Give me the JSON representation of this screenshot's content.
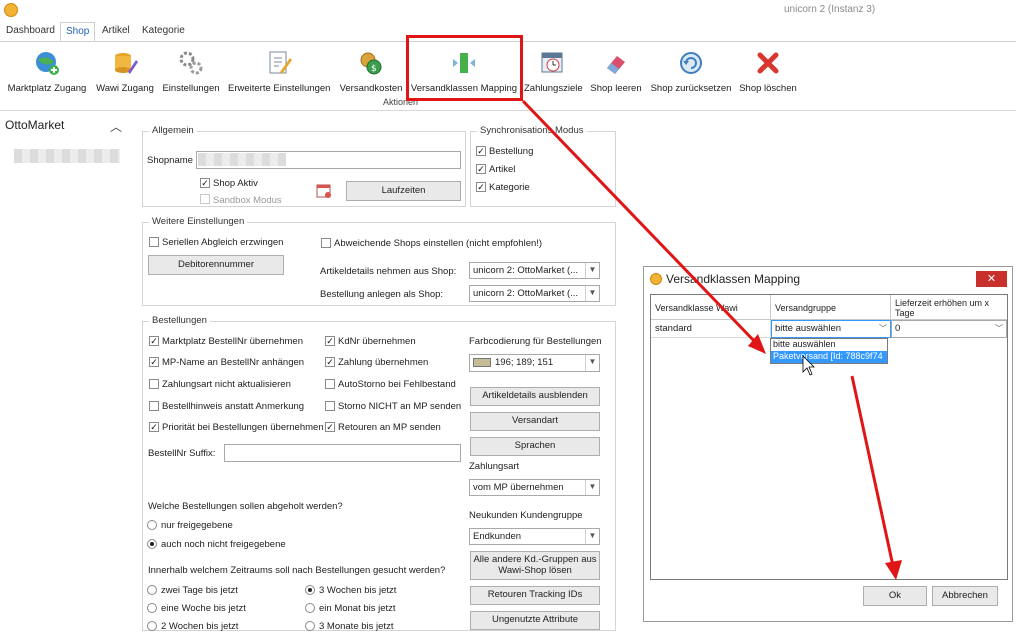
{
  "window": {
    "title": "unicorn 2 (Instanz 3)"
  },
  "tabs": [
    "Dashboard",
    "Shop",
    "Artikel",
    "Kategorie"
  ],
  "ribbon": {
    "group_label": "Aktionen",
    "buttons": [
      {
        "label": "Marktplatz Zugang",
        "icon": "globe-plus-icon"
      },
      {
        "label": "Wawi Zugang",
        "icon": "database-pencil-icon"
      },
      {
        "label": "Einstellungen",
        "icon": "gears-icon"
      },
      {
        "label": "Erweiterte Einstellungen",
        "icon": "document-pencil-icon"
      },
      {
        "label": "Versandkosten",
        "icon": "coins-icon"
      },
      {
        "label": "Versandklassen Mapping",
        "icon": "mapping-arrows-icon"
      },
      {
        "label": "Zahlungsziele",
        "icon": "calendar-clock-icon"
      },
      {
        "label": "Shop leeren",
        "icon": "eraser-icon"
      },
      {
        "label": "Shop zurücksetzen",
        "icon": "reset-icon"
      },
      {
        "label": "Shop löschen",
        "icon": "red-x-icon"
      }
    ]
  },
  "sidebar": {
    "title": "OttoMarket"
  },
  "allgemein": {
    "title": "Allgemein",
    "shopname_label": "Shopname",
    "shop_aktiv": "Shop Aktiv",
    "sandbox": "Sandbox Modus",
    "laufzeiten": "Laufzeiten"
  },
  "sync": {
    "title": "Synchronisations Modus",
    "items": [
      "Bestellung",
      "Artikel",
      "Kategorie"
    ]
  },
  "weitere": {
    "title": "Weitere Einstellungen",
    "seriellen": "Seriellen Abgleich erzwingen",
    "debitoren": "Debitorennummer",
    "abweichende": "Abweichende Shops einstellen (nicht empfohlen!)",
    "artikeldetails_label": "Artikeldetails nehmen aus Shop:",
    "artikeldetails_value": "unicorn 2: OttoMarket (...",
    "bestellung_label": "Bestellung anlegen als Shop:",
    "bestellung_value": "unicorn 2: OttoMarket (..."
  },
  "bestellungen": {
    "title": "Bestellungen",
    "left_checks": [
      {
        "label": "Marktplatz BestellNr übernehmen",
        "checked": true
      },
      {
        "label": "MP-Name an BestellNr anhängen",
        "checked": true
      },
      {
        "label": "Zahlungsart nicht aktualisieren",
        "checked": false
      },
      {
        "label": "Bestellhinweis anstatt Anmerkung",
        "checked": false
      },
      {
        "label": "Priorität bei Bestellungen übernehmen",
        "checked": true
      }
    ],
    "mid_checks": [
      {
        "label": "KdNr übernehmen",
        "checked": true
      },
      {
        "label": "Zahlung übernehmen",
        "checked": true
      },
      {
        "label": "AutoStorno bei Fehlbestand",
        "checked": false
      },
      {
        "label": "Storno NICHT an MP senden",
        "checked": false
      },
      {
        "label": "Retouren an MP senden",
        "checked": true
      }
    ],
    "suffix_label": "BestellNr Suffix:",
    "farbcodierung_label": "Farbcodierung für Bestellungen",
    "farb_value": "196; 189; 151",
    "farb_color": "#c4bd97",
    "buttons": [
      "Artikeldetails ausblenden",
      "Versandart",
      "Sprachen"
    ],
    "zahlungsart_label": "Zahlungsart",
    "zahlungsart_value": "vom MP übernehmen",
    "neukunden_label": "Neukunden Kundengruppe",
    "neukunden_value": "Endkunden",
    "alle_andere": "Alle andere Kd.-Gruppen aus Wawi-Shop lösen",
    "retouren_tracking": "Retouren Tracking IDs",
    "ungenutzte": "Ungenutzte Attribute",
    "welche_q": "Welche Bestellungen sollen abgeholt werden?",
    "welche_opts": [
      "nur freigegebene",
      "auch noch nicht freigegebene"
    ],
    "zeitraum_q": "Innerhalb welchem Zeitraums soll nach Bestellungen gesucht werden?",
    "zeitraum_left": [
      "zwei Tage bis jetzt",
      "eine Woche bis jetzt",
      "2 Wochen bis jetzt"
    ],
    "zeitraum_right": [
      "3 Wochen bis jetzt",
      "ein Monat bis jetzt",
      "3 Monate bis jetzt"
    ]
  },
  "dialog": {
    "title": "Versandklassen Mapping",
    "close": "✕",
    "columns": [
      "Versandklasse Wawi",
      "Versandgruppe",
      "Lieferzeit erhöhen um x Tage"
    ],
    "row": {
      "klasse": "standard",
      "gruppe": "bitte auswählen",
      "lieferzeit": "0"
    },
    "dropdown": [
      "bitte auswählen",
      "Paketversand [Id: 788c9f74"
    ],
    "ok": "Ok",
    "abbrechen": "Abbrechen"
  },
  "colors": {
    "accent": "#1f5fb4",
    "highlight": "#e01616"
  }
}
